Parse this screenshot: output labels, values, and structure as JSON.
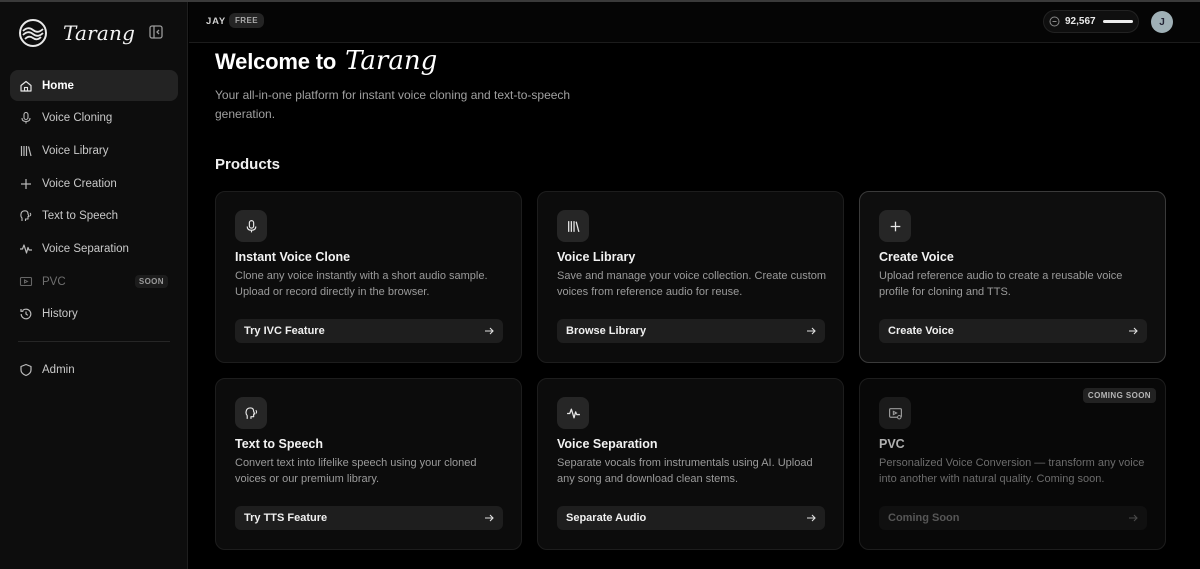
{
  "brand": {
    "name": "Tarang"
  },
  "sidebar": {
    "items": [
      {
        "label": "Home",
        "icon": "home-icon",
        "active": true
      },
      {
        "label": "Voice Cloning",
        "icon": "microphone-icon"
      },
      {
        "label": "Voice Library",
        "icon": "library-icon"
      },
      {
        "label": "Voice Creation",
        "icon": "plus-icon"
      },
      {
        "label": "Text to Speech",
        "icon": "speaking-head-icon"
      },
      {
        "label": "Voice Separation",
        "icon": "waveform-icon"
      },
      {
        "label": "PVC",
        "icon": "screen-settings-icon",
        "badge": "SOON",
        "disabled": true
      },
      {
        "label": "History",
        "icon": "history-icon"
      }
    ],
    "admin": {
      "label": "Admin",
      "icon": "shield-icon"
    }
  },
  "topbar": {
    "user": "JAY",
    "plan": "FREE",
    "credits": "92,567",
    "avatar_initial": "J"
  },
  "main": {
    "welcome": "Welcome to",
    "welcome_brand": "Tarang",
    "subtitle": "Your all-in-one platform for instant voice cloning and text-to-speech generation.",
    "section_title": "Products",
    "cards": [
      {
        "title": "Instant Voice Clone",
        "description": "Clone any voice instantly with a short audio sample. Upload or record directly in the browser.",
        "button": "Try IVC Feature",
        "icon": "microphone-icon"
      },
      {
        "title": "Voice Library",
        "description": "Save and manage your voice collection. Create custom voices from reference audio for reuse.",
        "button": "Browse Library",
        "icon": "library-icon"
      },
      {
        "title": "Create Voice",
        "description": "Upload reference audio to create a reusable voice profile for cloning and TTS.",
        "button": "Create Voice",
        "icon": "plus-icon"
      },
      {
        "title": "Text to Speech",
        "description": "Convert text into lifelike speech using your cloned voices or our premium library.",
        "button": "Try TTS Feature",
        "icon": "speaking-head-icon"
      },
      {
        "title": "Voice Separation",
        "description": "Separate vocals from instrumentals using AI. Upload any song and download clean stems.",
        "button": "Separate Audio",
        "icon": "waveform-icon"
      },
      {
        "title": "PVC",
        "description": "Personalized Voice Conversion — transform any voice into another with natural quality. Coming soon.",
        "button": "Coming Soon",
        "icon": "screen-settings-icon",
        "badge": "COMING SOON"
      }
    ]
  },
  "colors": {
    "background": "#000000",
    "sidebar": "#0d0d0d",
    "card": "#0c0c0c",
    "accent": "#ffffff"
  }
}
